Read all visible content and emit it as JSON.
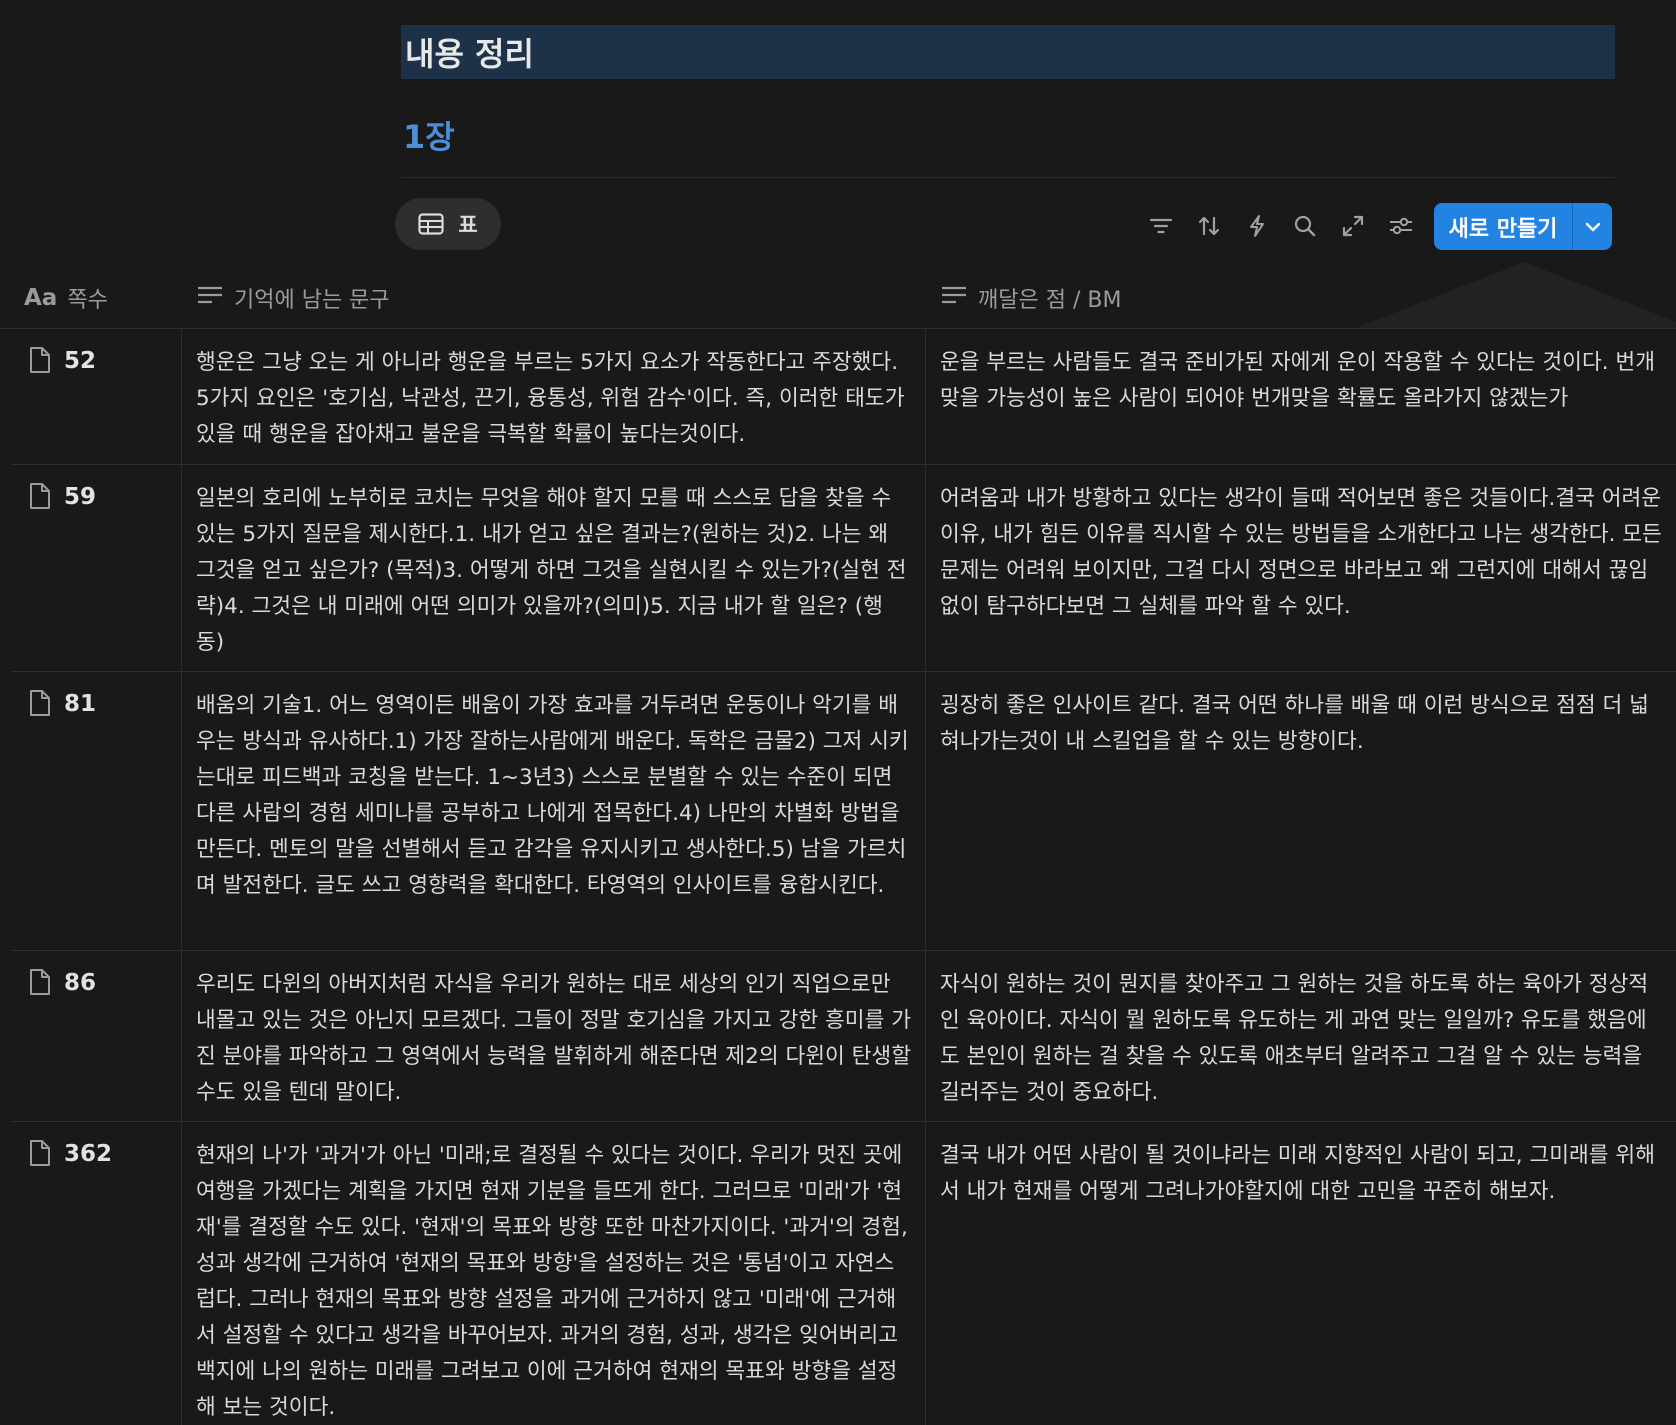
{
  "page": {
    "heading": "내용 정리",
    "chapter": "1장"
  },
  "view_tab": {
    "label": "표",
    "icon": "table-icon"
  },
  "toolbar": {
    "icons": [
      "filter-icon",
      "sort-icon",
      "lightning-icon",
      "search-icon",
      "expand-icon",
      "settings-sliders-icon"
    ],
    "new_button_label": "새로 만들기",
    "accent_color": "#2383e2"
  },
  "table": {
    "columns": [
      {
        "icon": "Aa",
        "label": "쪽수"
      },
      {
        "icon": "text-lines-icon",
        "label": "기억에 남는 문구"
      },
      {
        "icon": "text-lines-icon",
        "label": "깨달은 점 / BM"
      }
    ],
    "rows": [
      {
        "page": "52",
        "memo": "행운은 그냥 오는 게 아니라 행운을 부르는 5가지 요소가 작동한다고 주장했다. 5가지 요인은 '호기심, 낙관성, 끈기, 융통성, 위험 감수'이다. 즉, 이러한 태도가 있을 때 행운을 잡아채고 불운을 극복할 확률이 높다는것이다.",
        "insight": "운을 부르는 사람들도 결국 준비가된 자에게 운이 작용할 수 있다는 것이다. 번개 맞을 가능성이 높은 사람이 되어야 번개맞을 확률도 올라가지 않겠는가"
      },
      {
        "page": "59",
        "memo": "일본의 호리에 노부히로 코치는 무엇을 해야 할지 모를 때 스스로 답을 찾을 수 있는 5가지 질문을 제시한다.1. 내가 얻고 싶은 결과는?(원하는 것)2. 나는 왜 그것을 얻고 싶은가? (목적)3. 어떻게 하면 그것을 실현시킬 수 있는가?(실현 전략)4. 그것은 내 미래에 어떤 의미가 있을까?(의미)5. 지금 내가 할 일은? (행동)",
        "insight": "어려움과 내가 방황하고 있다는 생각이 들때 적어보면 좋은 것들이다.결국 어려운 이유, 내가 힘든 이유를 직시할 수 있는 방법들을 소개한다고 나는 생각한다. 모든 문제는 어려워 보이지만, 그걸 다시 정면으로 바라보고 왜 그런지에 대해서 끊임없이 탐구하다보면 그 실체를 파악 할 수 있다."
      },
      {
        "page": "81",
        "memo": "배움의 기술1. 어느 영역이든 배움이 가장 효과를 거두려면 운동이나 악기를 배우는 방식과 유사하다.1) 가장 잘하는사람에게 배운다. 독학은 금물2) 그저 시키는대로 피드백과 코칭을 받는다. 1~3년3) 스스로 분별할 수 있는 수준이 되면 다른 사람의 경험 세미나를 공부하고 나에게 접목한다.4) 나만의 차별화 방법을 만든다. 멘토의 말을 선별해서 듣고 감각을 유지시키고 생사한다.5) 남을 가르치며 발전한다. 글도 쓰고 영향력을 확대한다. 타영역의 인사이트를 융합시킨다.",
        "insight": "굉장히 좋은 인사이트 같다. 결국 어떤 하나를 배울 때 이런 방식으로 점점 더 넓혀나가는것이 내 스킬업을 할 수 있는 방향이다."
      },
      {
        "page": "86",
        "memo": "우리도 다윈의 아버지처럼 자식을 우리가 원하는 대로 세상의 인기 직업으로만 내몰고 있는 것은 아닌지 모르겠다. 그들이 정말 호기심을 가지고 강한 흥미를 가진 분야를 파악하고 그 영역에서 능력을 발휘하게 해준다면 제2의 다윈이 탄생할 수도 있을 텐데 말이다.",
        "insight": "자식이 원하는 것이 뭔지를 찾아주고 그 원하는 것을 하도록 하는 육아가 정상적인 육아이다. 자식이 뭘 원하도록 유도하는 게 과연 맞는 일일까? 유도를 했음에도 본인이 원하는 걸 찾을 수 있도록 애초부터 알려주고 그걸 알 수  있는 능력을 길러주는 것이 중요하다."
      },
      {
        "page": "362",
        "memo": "현재의 나'가 '과거'가 아닌 '미래;로 결정될 수 있다는 것이다. 우리가 멋진 곳에 여행을 가겠다는 계획을 가지면 현재 기분을 들뜨게 한다. 그러므로 '미래'가 '현재'를 결정할 수도 있다. '현재'의 목표와 방향 또한 마찬가지이다. '과거'의 경험, 성과 생각에 근거하여 '현재의 목표와 방향'을 설정하는 것은 '통념'이고 자연스럽다. 그러나 현재의 목표와 방향 설정을 과거에 근거하지 않고 '미래'에 근거해서 설정할 수 있다고 생각을 바꾸어보자. 과거의 경험, 성과, 생각은 잊어버리고 백지에 나의 원하는 미래를 그려보고 이에 근거하여 현재의 목표와 방향을 설정해 보는 것이다.",
        "insight": "결국 내가 어떤 사람이 될 것이냐라는 미래 지향적인 사람이 되고, 그미래를 위해서 내가 현재를 어떻게 그려나가야할지에 대한 고민을 꾸준히 해보자."
      }
    ]
  }
}
